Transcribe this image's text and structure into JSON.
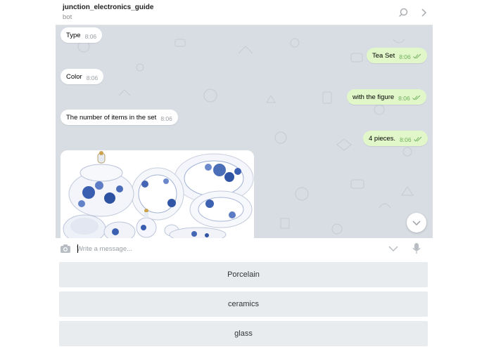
{
  "header": {
    "title": "junction_electronics_guide",
    "subtitle": "bot",
    "search_icon": "search-icon",
    "more_icon": "chevron-right-icon"
  },
  "messages": [
    {
      "direction": "in",
      "text": "Type",
      "time": "8:06"
    },
    {
      "direction": "out",
      "text": "Tea Set",
      "time": "8:06",
      "status": "read"
    },
    {
      "direction": "in",
      "text": "Color",
      "time": "8:06"
    },
    {
      "direction": "out",
      "text": "with the figure",
      "time": "8:06",
      "status": "read"
    },
    {
      "direction": "in",
      "text": "The number of items in the set",
      "time": "8:06"
    },
    {
      "direction": "out",
      "text": "4 pieces.",
      "time": "8:06",
      "status": "read"
    }
  ],
  "photo": {
    "description_icon": "porcelain-tea-set-image"
  },
  "composer": {
    "placeholder": "Write a message...",
    "camera_icon": "camera-icon",
    "keyboard_toggle_icon": "chevron-down-icon",
    "mic_icon": "microphone-icon"
  },
  "keyboard": {
    "buttons": [
      "Porcelain",
      "ceramics",
      "glass"
    ]
  },
  "colors": {
    "chat_background": "#d7dde3",
    "incoming_bubble": "#ffffff",
    "outgoing_bubble": "#e2f7c9",
    "keyboard_button": "#e9ecef"
  }
}
